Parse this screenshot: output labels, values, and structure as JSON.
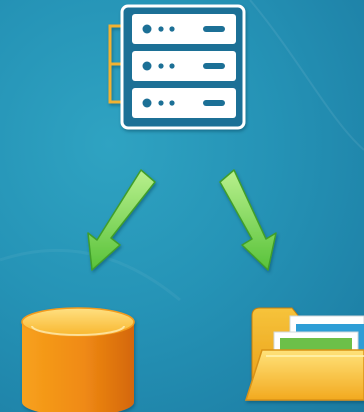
{
  "diagram": {
    "nodes": [
      {
        "id": "server",
        "icon": "server-icon"
      },
      {
        "id": "database",
        "icon": "database-icon"
      },
      {
        "id": "folder",
        "icon": "folder-icon"
      }
    ],
    "edges": [
      {
        "from": "server",
        "to": "database",
        "icon": "arrow-down-left-icon"
      },
      {
        "from": "server",
        "to": "folder",
        "icon": "arrow-down-right-icon"
      }
    ]
  },
  "colors": {
    "background": "#2593b6",
    "server_body": "#1f6f96",
    "server_panel": "#ffffff",
    "server_bracket": "#f2b233",
    "arrow_green": "#7ed957",
    "database_orange": "#f59a1b",
    "folder_yellow": "#f7c63c"
  }
}
